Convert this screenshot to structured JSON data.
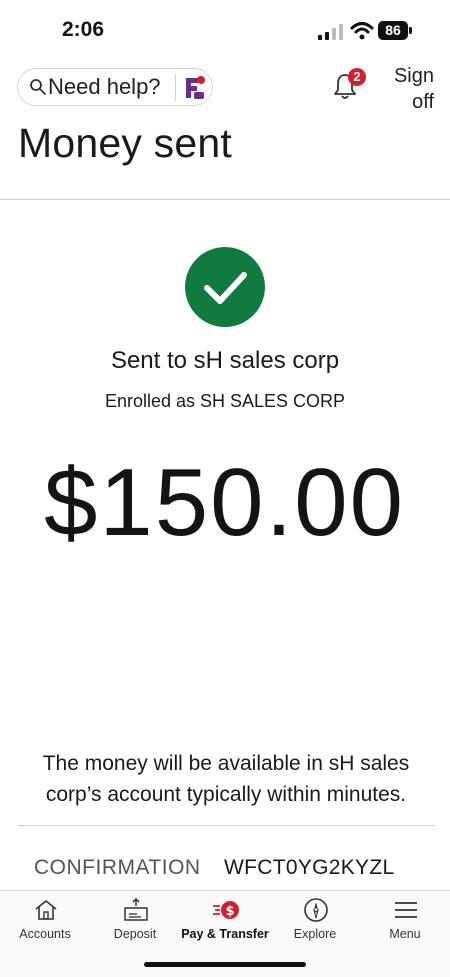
{
  "status_bar": {
    "time": "2:06",
    "battery": "86"
  },
  "header": {
    "help_label": "Need help?",
    "notification_count": "2",
    "sign_off_line1": "Sign",
    "sign_off_line2": "off",
    "page_title": "Money sent"
  },
  "confirmation": {
    "sent_to": "Sent to sH sales corp",
    "enrolled_as": "Enrolled as SH SALES CORP",
    "amount": "$150.00",
    "availability_message": "The money will be available in sH sales corp’s account typically within minutes.",
    "confirmation_label": "CONFIRMATION",
    "confirmation_code": "WFCT0YG2KYZL"
  },
  "nav": {
    "items": [
      {
        "label": "Accounts",
        "icon": "home-icon"
      },
      {
        "label": "Deposit",
        "icon": "deposit-check-icon"
      },
      {
        "label": "Pay & Transfer",
        "icon": "pay-transfer-icon"
      },
      {
        "label": "Explore",
        "icon": "compass-icon"
      },
      {
        "label": "Menu",
        "icon": "hamburger-menu-icon"
      }
    ],
    "active_index": 2
  },
  "colors": {
    "accent_red": "#d71e28",
    "success_green": "#117a3e",
    "logo_purple": "#6b2c91"
  }
}
